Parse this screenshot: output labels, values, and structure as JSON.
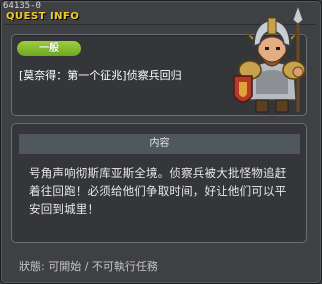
{
  "window": {
    "quest_id": "64135-0",
    "title": "QUEST INFO"
  },
  "quest": {
    "category": "一般",
    "title": "[莫奈得：第一个征兆]侦察兵回归"
  },
  "content": {
    "header": "内容",
    "body": "号角声响彻斯库亚斯全境。侦察兵被大批怪物追赶着往回跑！必须给他们争取时间，好让他们可以平安回到城里！"
  },
  "status": {
    "text": "狀態: 可開始 / 不可執行任務"
  },
  "npc": {
    "icon": "armored-warrior-npc-portrait"
  }
}
